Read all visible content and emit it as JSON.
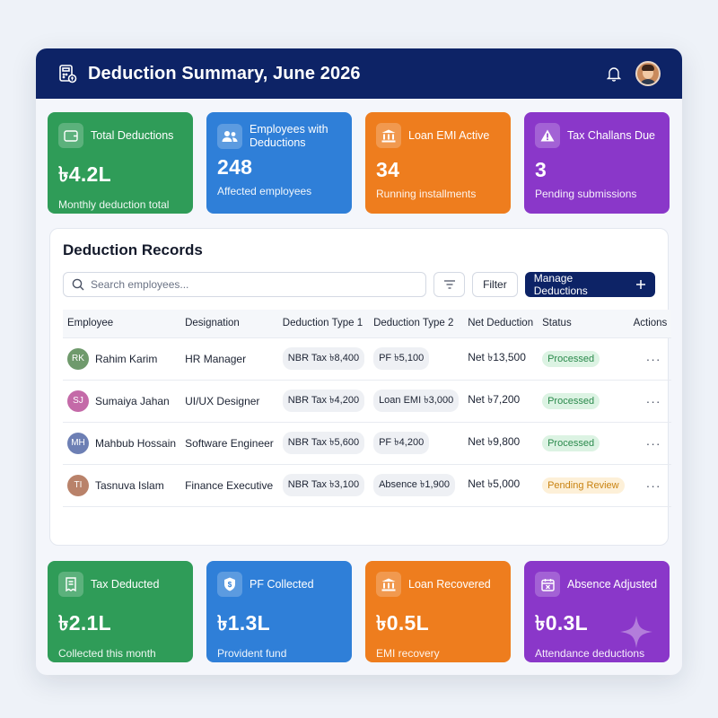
{
  "header": {
    "title": "Deduction Summary, June 2026"
  },
  "top_cards": [
    {
      "label": "Total Deductions",
      "value": "৳4.2L",
      "sub": "Monthly deduction total",
      "icon": "wallet-icon",
      "color": "#2f9c58"
    },
    {
      "label": "Employees with Deductions",
      "value": "248",
      "sub": "Affected employees",
      "icon": "users-icon",
      "color": "#2f7fd8"
    },
    {
      "label": "Loan EMI Active",
      "value": "34",
      "sub": "Running installments",
      "icon": "bank-icon",
      "color": "#ee7d1e"
    },
    {
      "label": "Tax Challans Due",
      "value": "3",
      "sub": "Pending submissions",
      "icon": "warning-icon",
      "color": "#8a37c9"
    }
  ],
  "records": {
    "title": "Deduction Records",
    "search_placeholder": "Search employees...",
    "filter_label": "Filter",
    "manage_label": "Manage Deductions",
    "columns": [
      "Employee",
      "Designation",
      "Deduction Type 1",
      "Deduction Type 2",
      "Net Deduction",
      "Status",
      "Actions"
    ],
    "rows": [
      {
        "initials": "RK",
        "avatar_color": "#6f9a6c",
        "name": "Rahim Karim",
        "designation": "HR Manager",
        "d1": "NBR Tax ৳8,400",
        "d2": "PF ৳5,100",
        "net": "Net ৳13,500",
        "status": "Processed"
      },
      {
        "initials": "SJ",
        "avatar_color": "#c46aa8",
        "name": "Sumaiya Jahan",
        "designation": "UI/UX Designer",
        "d1": "NBR Tax ৳4,200",
        "d2": "Loan EMI ৳3,000",
        "net": "Net ৳7,200",
        "status": "Processed"
      },
      {
        "initials": "MH",
        "avatar_color": "#6d7fb4",
        "name": "Mahbub Hossain",
        "designation": "Software Engineer",
        "d1": "NBR Tax ৳5,600",
        "d2": "PF ৳4,200",
        "net": "Net ৳9,800",
        "status": "Processed"
      },
      {
        "initials": "TI",
        "avatar_color": "#b9826a",
        "name": "Tasnuva Islam",
        "designation": "Finance Executive",
        "d1": "NBR Tax ৳3,100",
        "d2": "Absence ৳1,900",
        "net": "Net ৳5,000",
        "status": "Pending Review"
      }
    ],
    "actions_glyph": "···"
  },
  "bottom_cards": [
    {
      "label": "Tax Deducted",
      "value": "৳2.1L",
      "sub": "Collected this month",
      "icon": "receipt-icon",
      "color": "#2f9c58"
    },
    {
      "label": "PF Collected",
      "value": "৳1.3L",
      "sub": "Provident fund",
      "icon": "shield-dollar-icon",
      "color": "#2f7fd8"
    },
    {
      "label": "Loan Recovered",
      "value": "৳0.5L",
      "sub": "EMI recovery",
      "icon": "bank-icon",
      "color": "#ee7d1e"
    },
    {
      "label": "Absence Adjusted",
      "value": "৳0.3L",
      "sub": "Attendance deductions",
      "icon": "calendar-x-icon",
      "color": "#8a37c9"
    }
  ]
}
